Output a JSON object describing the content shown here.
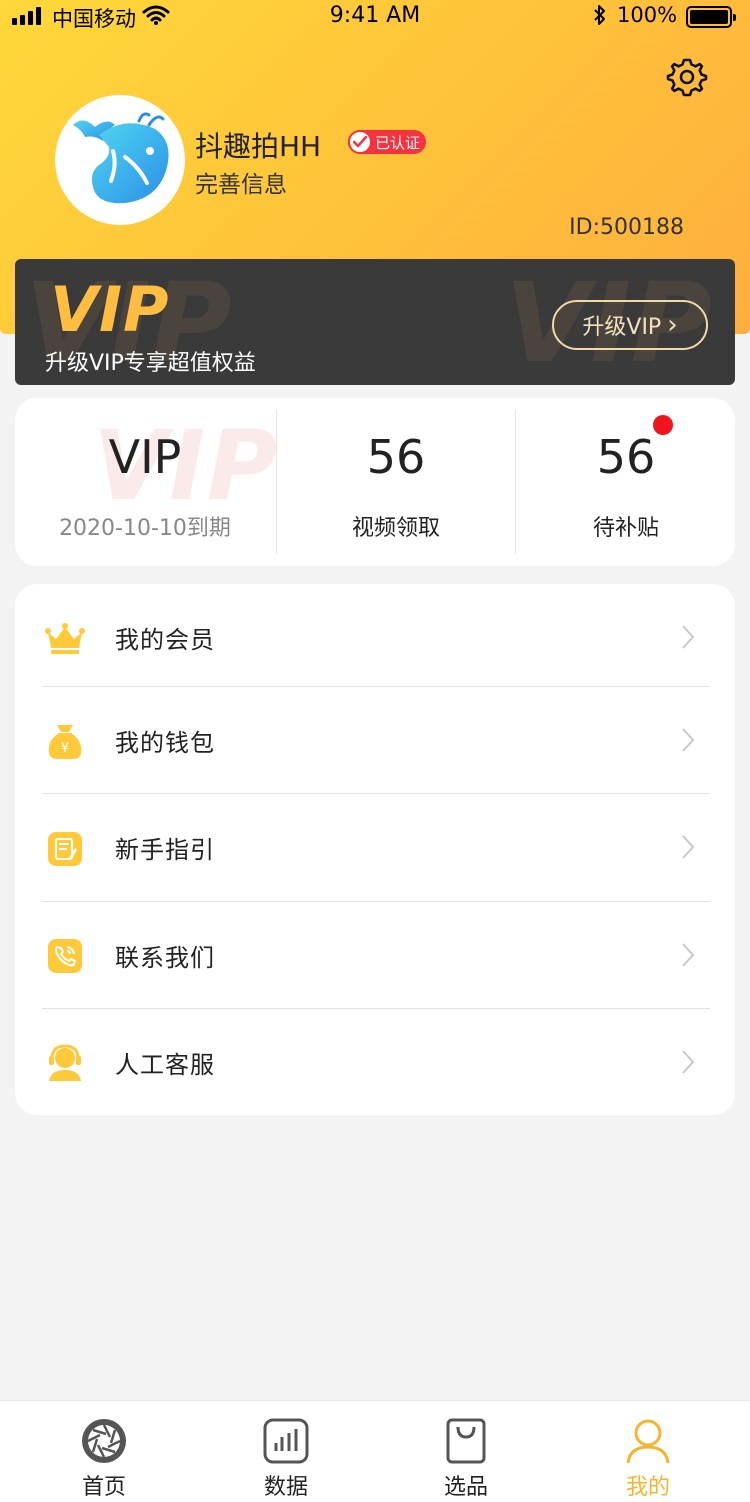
{
  "status_bar": {
    "carrier": "中国移动",
    "time": "9:41 AM",
    "battery": "100%"
  },
  "profile": {
    "username": "抖趣拍HH",
    "verified_label": "已认证",
    "complete_info": "完善信息",
    "user_id": "ID:500188"
  },
  "vip_banner": {
    "logo_text": "VIP",
    "bg_word": "VIP",
    "subtitle": "升级VIP专享超值权益",
    "upgrade_button": "升级VIP",
    "upgrade_chevron": "›"
  },
  "stats": {
    "items": [
      {
        "value": "VIP",
        "label": "2020-10-10到期",
        "watermark": "VIP"
      },
      {
        "value": "56",
        "label": "视频领取"
      },
      {
        "value": "56",
        "label": "待补贴"
      }
    ]
  },
  "menu": {
    "items": [
      {
        "label": "我的会员",
        "icon": "crown-icon"
      },
      {
        "label": "我的钱包",
        "icon": "money-bag-icon"
      },
      {
        "label": "新手指引",
        "icon": "guide-note-icon"
      },
      {
        "label": "联系我们",
        "icon": "phone-icon"
      },
      {
        "label": "人工客服",
        "icon": "customer-service-icon"
      }
    ]
  },
  "tabbar": {
    "items": [
      {
        "label": "首页",
        "icon": "aperture-icon"
      },
      {
        "label": "数据",
        "icon": "bar-chart-icon"
      },
      {
        "label": "选品",
        "icon": "shopping-bag-icon"
      },
      {
        "label": "我的",
        "icon": "person-icon",
        "active": true
      }
    ]
  },
  "colors": {
    "header_gradient_start": "#ffd83a",
    "header_gradient_end": "#ffae3e",
    "accent": "#f5b52f",
    "vip_gold": "#ffbd42",
    "badge_red": "#f5333f",
    "notification_dot": "#f0141e"
  }
}
